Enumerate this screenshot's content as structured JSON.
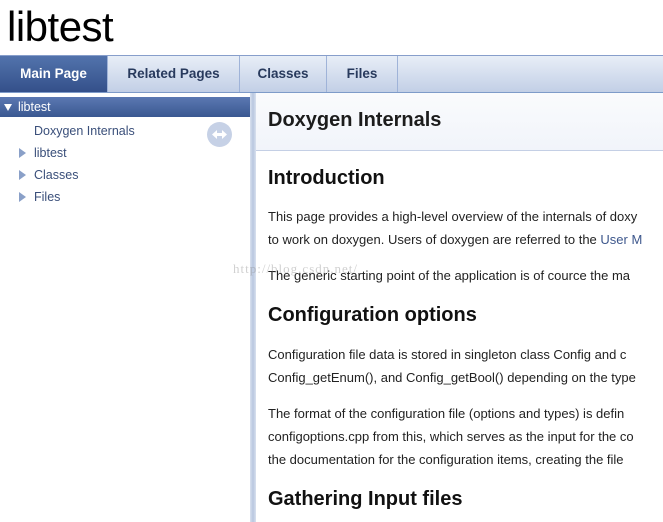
{
  "project": {
    "name": "libtest"
  },
  "tabs": [
    {
      "label": "Main Page",
      "active": true
    },
    {
      "label": "Related Pages",
      "active": false
    },
    {
      "label": "Classes",
      "active": false
    },
    {
      "label": "Files",
      "active": false
    }
  ],
  "sidebar": {
    "root": "libtest",
    "items": [
      {
        "label": "Doxygen Internals",
        "expandable": false
      },
      {
        "label": "libtest",
        "expandable": true
      },
      {
        "label": "Classes",
        "expandable": true
      },
      {
        "label": "Files",
        "expandable": true
      }
    ],
    "sync_icon": "sync-arrows-icon"
  },
  "content": {
    "title": "Doxygen Internals",
    "sections": [
      {
        "heading": "Introduction",
        "lines": [
          "This page provides a high-level overview of the internals of doxy",
          "to work on doxygen. Users of doxygen are referred to the ",
          "The generic starting point of the application is of cource the ma"
        ],
        "link": "User M"
      },
      {
        "heading": "Configuration options",
        "lines": [
          "Configuration file data is stored in singleton class Config and c",
          "Config_getEnum(), and Config_getBool() depending on the type",
          "The format of the configuration file (options and types) is defin",
          "configoptions.cpp from this, which serves as the input for the co",
          "the documentation for the configuration items, creating the file"
        ]
      },
      {
        "heading": "Gathering Input files"
      }
    ]
  },
  "watermark": "http://blog.csdn.net/",
  "colors": {
    "tab_active": "#34508a",
    "link": "#3d578c",
    "nav_root": "#3a5891"
  }
}
